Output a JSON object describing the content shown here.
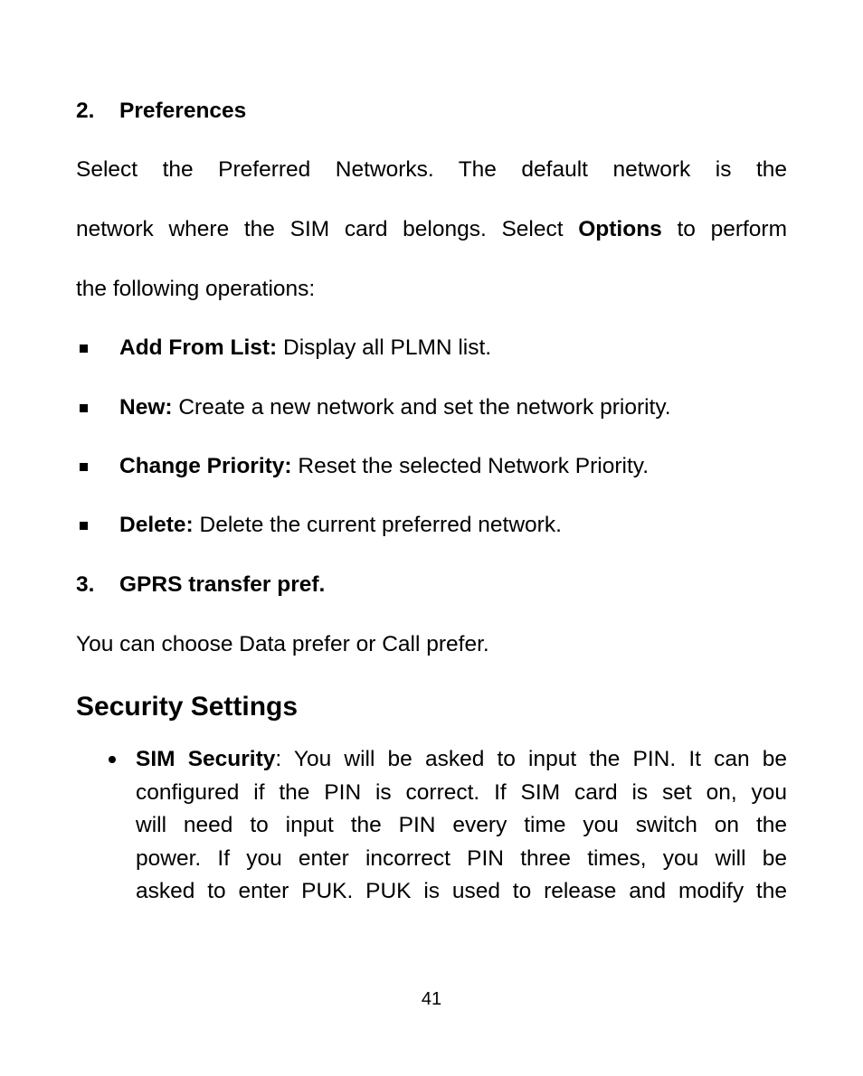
{
  "document": {
    "preferences": {
      "number": "2.",
      "title": "Preferences",
      "paragraph_lines": [
        "Select the Preferred Networks. The default network is the",
        {
          "before": "network where the SIM card belongs. Select ",
          "bold": "Options",
          "after": " to perform"
        },
        "the following operations:"
      ],
      "items": [
        {
          "label": "Add From List:",
          "text": " Display all PLMN list."
        },
        {
          "label": "New:",
          "text": " Create a new network and set the network priority."
        },
        {
          "label": "Change Priority:",
          "text": " Reset the selected Network Priority."
        },
        {
          "label": "Delete:",
          "text": " Delete the current preferred network."
        }
      ]
    },
    "gprs": {
      "number": "3.",
      "title": "GPRS transfer pref.",
      "text": "You can choose Data prefer or Call prefer."
    },
    "security": {
      "title": "Security Settings",
      "items": [
        {
          "label": "SIM Security",
          "lines": [
            ": You will be asked to input the PIN. It can be",
            "configured if the PIN is correct. If SIM card is set on, you",
            "will need to input the PIN every time you switch on the",
            "power. If you enter incorrect PIN three times, you will be",
            "asked to enter PUK. PUK is used to release and modify the"
          ]
        }
      ]
    },
    "page_number": "41"
  }
}
